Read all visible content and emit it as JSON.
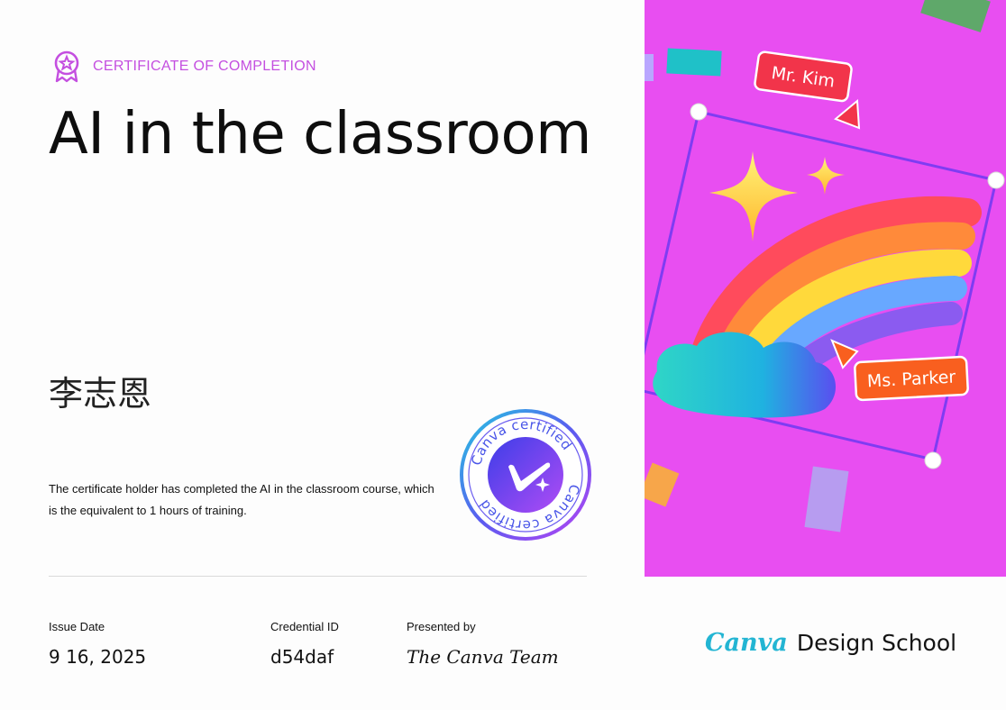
{
  "header": {
    "kicker": "CERTIFICATE OF COMPLETION",
    "badge_icon": "award-ribbon-icon"
  },
  "course": {
    "title": "AI in the classroom"
  },
  "recipient": {
    "name": "李志恩"
  },
  "description": "The certificate holder has completed the AI in the classroom course, which is the equivalent to 1 hours of training.",
  "seal": {
    "ring_text": "Canva certified",
    "icon": "check-sparkle-icon"
  },
  "meta": {
    "issue_date_label": "Issue Date",
    "issue_date": "9 16, 2025",
    "credential_label": "Credential ID",
    "credential_id": "d54daf",
    "presented_label": "Presented by",
    "presented_by": "The Canva Team"
  },
  "artwork": {
    "tag_top": "Mr. Kim",
    "tag_bottom": "Ms. Parker",
    "background": "#e84ef1"
  },
  "brand": {
    "logo": "Canva",
    "suffix": "Design School"
  },
  "colors": {
    "accent": "#c44fe0",
    "brand_teal": "#23b5d3",
    "tag_red": "#f2344a",
    "tag_orange": "#f95f1f"
  }
}
